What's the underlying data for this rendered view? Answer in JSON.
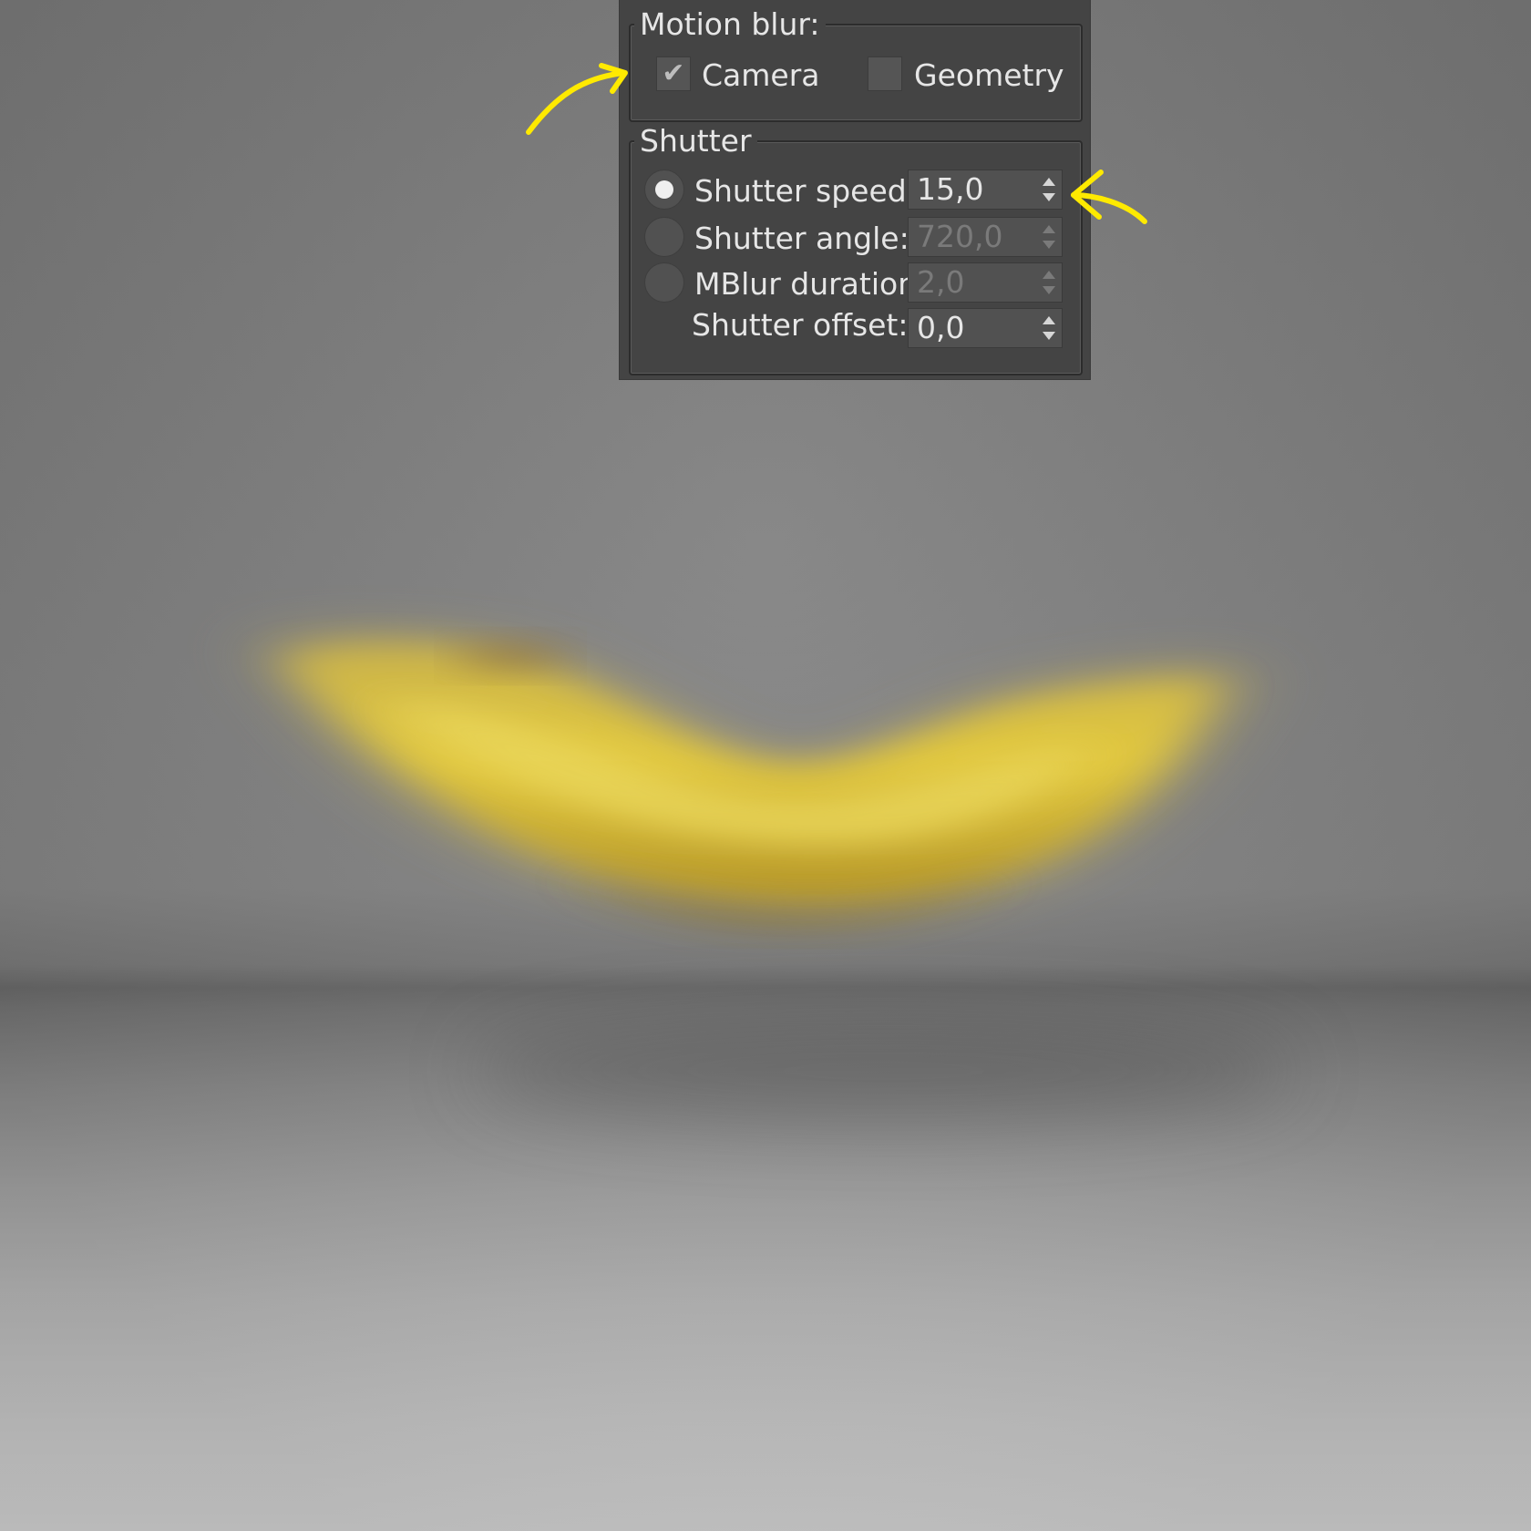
{
  "motion_blur": {
    "title": "Motion blur:",
    "camera": {
      "label": "Camera",
      "checked": true
    },
    "geometry": {
      "label": "Geometry",
      "checked": false
    }
  },
  "shutter": {
    "title": "Shutter",
    "rows": [
      {
        "label": "Shutter speed:",
        "value": "15,0",
        "selected": true,
        "enabled": true
      },
      {
        "label": "Shutter angle:",
        "value": "720,0",
        "selected": false,
        "enabled": false
      },
      {
        "label": "MBlur duration:",
        "value": "2,0",
        "selected": false,
        "enabled": false
      },
      {
        "label": "Shutter offset:",
        "value": "0,0",
        "selected": null,
        "enabled": true
      }
    ]
  },
  "colors": {
    "panel_bg": "#444444",
    "annotation_arrow": "#ffea00",
    "banana": "#e2c43a"
  },
  "icons": {
    "check": "checkmark-icon",
    "spin": "spinner-arrows-icon",
    "annotation": "hand-drawn-arrow-icon"
  }
}
